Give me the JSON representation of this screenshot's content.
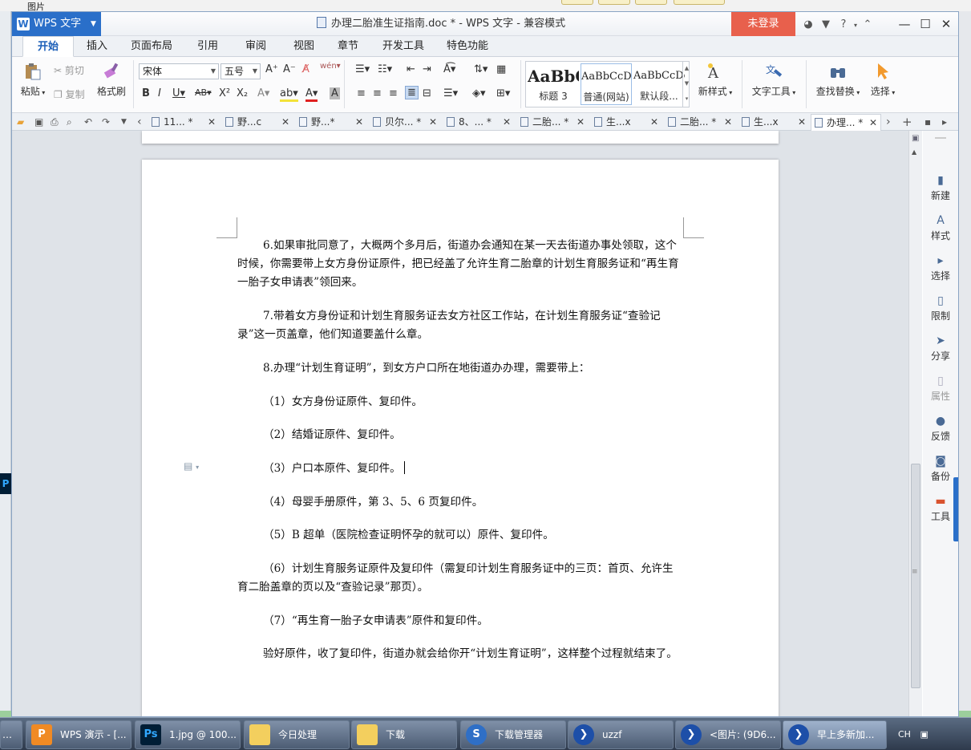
{
  "background": {
    "top_text": "图片"
  },
  "titlebar": {
    "app_name": "WPS 文字",
    "doc_title": "办理二胎准生证指南.doc * - WPS 文字 - 兼容模式",
    "login": "未登录",
    "help": "?"
  },
  "ribbon_tabs": [
    "开始",
    "插入",
    "页面布局",
    "引用",
    "审阅",
    "视图",
    "章节",
    "开发工具",
    "特色功能"
  ],
  "ribbon": {
    "paste": "粘贴",
    "cut": "剪切",
    "copy": "复制",
    "format_painter": "格式刷",
    "font_name": "宋体",
    "font_size": "五号",
    "styles": [
      {
        "preview": "AaBbC",
        "name": "标题 3"
      },
      {
        "preview": "AaBbCcDc",
        "name": "普通(网站)"
      },
      {
        "preview": "AaBbCcDc",
        "name": "默认段..."
      }
    ],
    "new_style": "新样式",
    "text_tools": "文字工具",
    "find_replace": "查找替换",
    "select": "选择"
  },
  "doc_tabs": [
    "11... *",
    "野...c",
    "野...*",
    "贝尔... *",
    "8、... *",
    "二胎... *",
    "生...x",
    "二胎... *",
    "生...x",
    "办理... *"
  ],
  "document": {
    "paragraphs": [
      "6.如果审批同意了，大概两个多月后，街道办会通知在某一天去街道办事处领取，这个时候，你需要带上女方身份证原件，把已经盖了允许生育二胎章的计划生育服务证和“再生育一胎子女申请表”领回来。",
      "7.带着女方身份证和计划生育服务证去女方社区工作站，在计划生育服务证“查验记录”这一页盖章，他们知道要盖什么章。",
      "8.办理“计划生育证明”，到女方户口所在地街道办办理，需要带上：",
      "（1）女方身份证原件、复印件。",
      "（2）结婚证原件、复印件。",
      "（3）户口本原件、复印件。",
      "（4）母婴手册原件，第 3、5、6 页复印件。",
      "（5）B 超单（医院检查证明怀孕的就可以）原件、复印件。",
      "（6）计划生育服务证原件及复印件（需复印计划生育服务证中的三页：首页、允许生育二胎盖章的页以及“查验记录”那页）。",
      "（7）“再生育一胎子女申请表”原件和复印件。",
      "验好原件，收了复印件，街道办就会给你开“计划生育证明”，这样整个过程就结束了。"
    ]
  },
  "side_panel": [
    "新建",
    "样式",
    "选择",
    "限制",
    "分享",
    "属性",
    "反馈",
    "备份",
    "工具"
  ],
  "taskbar": {
    "items": [
      "WPS 演示 - [...",
      "1.jpg @ 100...",
      "今日处理",
      "下载",
      "下载管理器",
      "uzzf",
      "<图片: (9D6...",
      "早上多新加..."
    ],
    "tray": "CH"
  }
}
